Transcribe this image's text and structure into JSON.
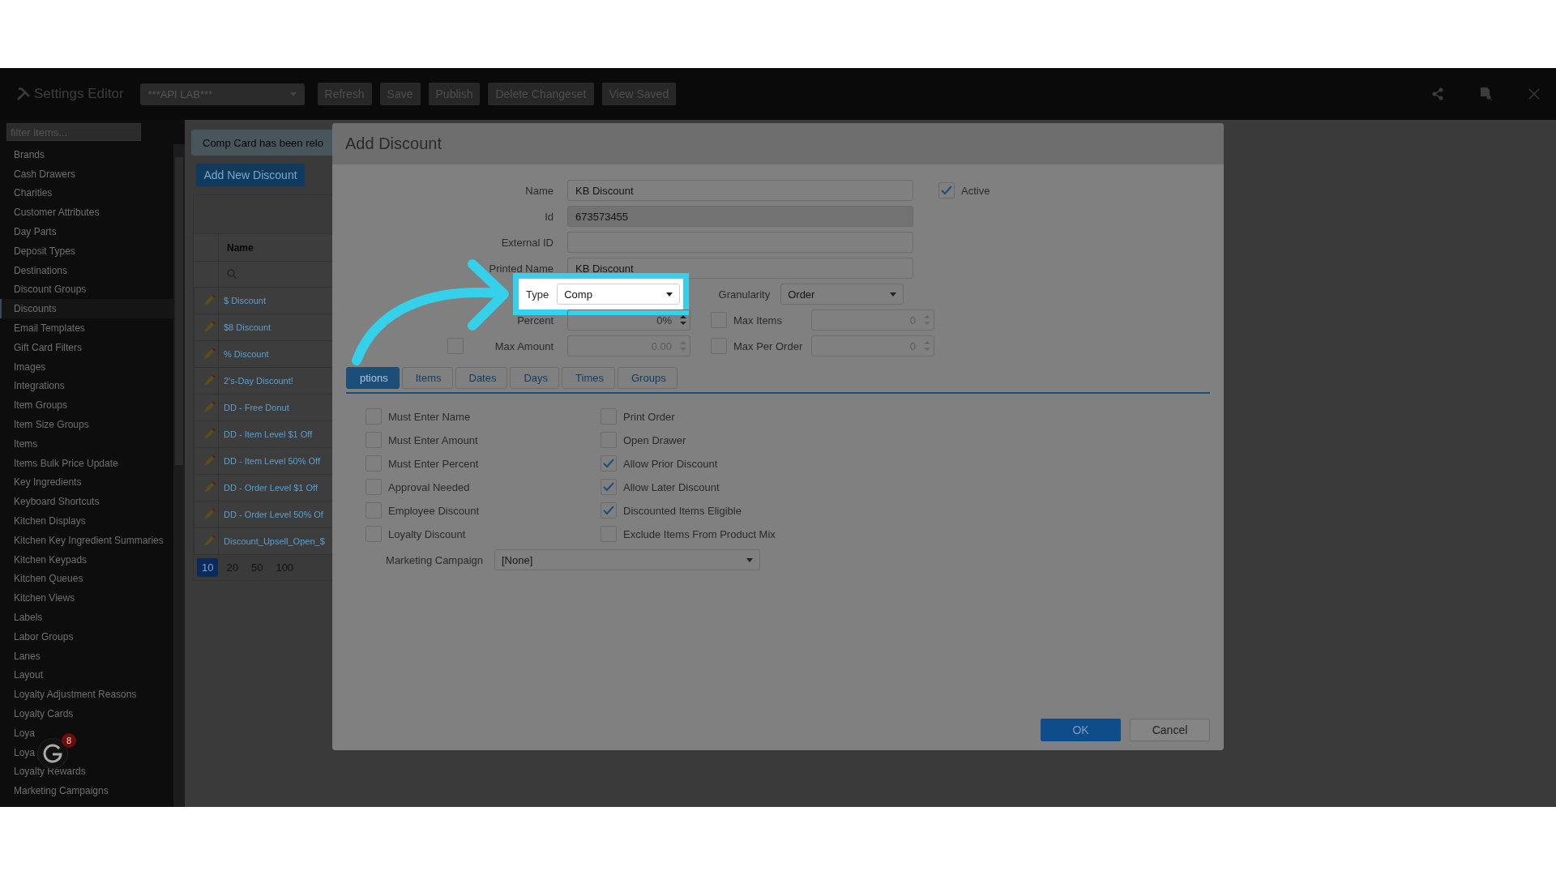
{
  "topbar": {
    "app_title": "Settings Editor",
    "environment": "***API LAB***",
    "buttons": [
      "Refresh",
      "Save",
      "Publish",
      "Delete Changeset",
      "View Saved"
    ]
  },
  "sidebar": {
    "filter_placeholder": "filter items...",
    "items": [
      {
        "label": "Brands",
        "selected": false
      },
      {
        "label": "Cash Drawers",
        "selected": false
      },
      {
        "label": "Charities",
        "selected": false
      },
      {
        "label": "Customer Attributes",
        "selected": false
      },
      {
        "label": "Day Parts",
        "selected": false
      },
      {
        "label": "Deposit Types",
        "selected": false
      },
      {
        "label": "Destinations",
        "selected": false
      },
      {
        "label": "Discount Groups",
        "selected": false
      },
      {
        "label": "Discounts",
        "selected": true
      },
      {
        "label": "Email Templates",
        "selected": false
      },
      {
        "label": "Gift Card Filters",
        "selected": false
      },
      {
        "label": "Images",
        "selected": false
      },
      {
        "label": "Integrations",
        "selected": false
      },
      {
        "label": "Item Groups",
        "selected": false
      },
      {
        "label": "Item Size Groups",
        "selected": false
      },
      {
        "label": "Items",
        "selected": false
      },
      {
        "label": "Items Bulk Price Update",
        "selected": false
      },
      {
        "label": "Key Ingredients",
        "selected": false
      },
      {
        "label": "Keyboard Shortcuts",
        "selected": false
      },
      {
        "label": "Kitchen Displays",
        "selected": false
      },
      {
        "label": "Kitchen Key Ingredient Summaries",
        "selected": false
      },
      {
        "label": "Kitchen Keypads",
        "selected": false
      },
      {
        "label": "Kitchen Queues",
        "selected": false
      },
      {
        "label": "Kitchen Views",
        "selected": false
      },
      {
        "label": "Labels",
        "selected": false
      },
      {
        "label": "Labor Groups",
        "selected": false
      },
      {
        "label": "Lanes",
        "selected": false
      },
      {
        "label": "Layout",
        "selected": false
      },
      {
        "label": "Loyalty Adjustment Reasons",
        "selected": false
      },
      {
        "label": "Loyalty Cards",
        "selected": false
      },
      {
        "label": "Loya",
        "selected": false
      },
      {
        "label": "Loya",
        "selected": false
      },
      {
        "label": "Loyalty Rewards",
        "selected": false
      },
      {
        "label": "Marketing Campaigns",
        "selected": false
      }
    ]
  },
  "badge": {
    "count": "8"
  },
  "list": {
    "banner": "Comp Card has been relo",
    "add_button": "Add New Discount",
    "column": "Name",
    "rows": [
      "$ Discount",
      "$8 Discount",
      "% Discount",
      "2's-Day Discount!",
      "DD - Free Donut",
      "DD - Item Level $1 Off",
      "DD - Item Level 50% Off",
      "DD - Order Level $1 Off",
      "DD - Order Level 50% Of",
      "Discount_Upsell_Open_$"
    ],
    "page_sizes": [
      {
        "label": "10",
        "selected": true
      },
      {
        "label": "20",
        "selected": false
      },
      {
        "label": "50",
        "selected": false
      },
      {
        "label": "100",
        "selected": false
      }
    ]
  },
  "dialog": {
    "title": "Add Discount",
    "fields": [
      {
        "label": "Name",
        "value": "KB Discount",
        "disabled": false
      },
      {
        "label": "Id",
        "value": "673573455",
        "disabled": true
      },
      {
        "label": "External ID",
        "disabled": false
      },
      {
        "label": "Printed Name",
        "value": "KB Discount",
        "disabled": false
      }
    ],
    "active": {
      "label": "Active",
      "checked": true
    },
    "type": {
      "label": "Type",
      "value": "Comp"
    },
    "granularity": {
      "label": "Granularity",
      "value": "Order"
    },
    "percent": {
      "label": "Percent",
      "value": "0%"
    },
    "max_amount": {
      "label": "Max Amount",
      "checked": false,
      "value": "0.00"
    },
    "max_items": {
      "label": "Max Items",
      "checked": false,
      "value": "0"
    },
    "max_per_order": {
      "label": "Max Per Order",
      "checked": false,
      "value": "0"
    },
    "tabs": [
      {
        "label": "ptions",
        "selected": true
      },
      {
        "label": "Items",
        "selected": false
      },
      {
        "label": "Dates",
        "selected": false
      },
      {
        "label": "Days",
        "selected": false
      },
      {
        "label": "Times",
        "selected": false
      },
      {
        "label": "Groups",
        "selected": false
      }
    ],
    "options_left": [
      {
        "label": "Must Enter Name",
        "checked": false
      },
      {
        "label": "Must Enter Amount",
        "checked": false
      },
      {
        "label": "Must Enter Percent",
        "checked": false
      },
      {
        "label": "Approval Needed",
        "checked": false
      },
      {
        "label": "Employee Discount",
        "checked": false
      },
      {
        "label": "Loyalty Discount",
        "checked": false
      }
    ],
    "options_right": [
      {
        "label": "Print Order",
        "checked": false
      },
      {
        "label": "Open Drawer",
        "checked": false
      },
      {
        "label": "Allow Prior Discount",
        "checked": true
      },
      {
        "label": "Allow Later Discount",
        "checked": true
      },
      {
        "label": "Discounted Items Eligible",
        "checked": true
      },
      {
        "label": "Exclude Items From Product Mix",
        "checked": false
      }
    ],
    "marketing_campaign": {
      "label": "Marketing Campaign",
      "value": "[None]"
    },
    "buttons": [
      {
        "label": "OK",
        "kind": "primary"
      },
      {
        "label": "Cancel",
        "kind": "secondary"
      }
    ]
  }
}
